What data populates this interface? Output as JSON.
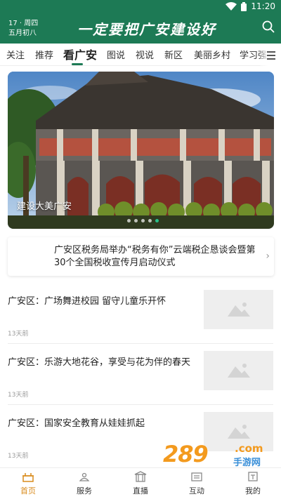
{
  "status": {
    "time": "11:20"
  },
  "header": {
    "date_line1": "17 · 周四",
    "date_line2": "五月初八",
    "brand_text": "一定要把广安建设好"
  },
  "tabs": [
    {
      "label": "关注"
    },
    {
      "label": "推荐"
    },
    {
      "label": "看广安",
      "active": true
    },
    {
      "label": "图说"
    },
    {
      "label": "视说"
    },
    {
      "label": "新区"
    },
    {
      "label": "美丽乡村"
    },
    {
      "label": "学习强"
    }
  ],
  "banner": {
    "caption": "建设大美广安",
    "slide_count": 5,
    "active_slide": 5
  },
  "notice": {
    "text": "广安区税务局举办“税务有你”云端税企恳谈会暨第30个全国税收宣传月启动仪式"
  },
  "news": [
    {
      "title": "广安区：广场舞进校园  留守儿童乐开怀",
      "time": "13天前"
    },
    {
      "title": "广安区：乐游大地花谷，享受与花为伴的春天",
      "time": "13天前"
    },
    {
      "title": "广安区：国家安全教育从娃娃抓起",
      "time": "13天前"
    }
  ],
  "watermark": {
    "number": "289",
    "com": ".com",
    "sub": "手游网"
  },
  "bottom_nav": [
    {
      "label": "首页",
      "icon": "home-icon",
      "active": true
    },
    {
      "label": "服务",
      "icon": "service-icon"
    },
    {
      "label": "直播",
      "icon": "live-icon"
    },
    {
      "label": "互动",
      "icon": "interact-icon"
    },
    {
      "label": "我的",
      "icon": "profile-icon"
    }
  ],
  "colors": {
    "brand_green": "#1d7a55",
    "active_orange": "#d98b1c"
  }
}
